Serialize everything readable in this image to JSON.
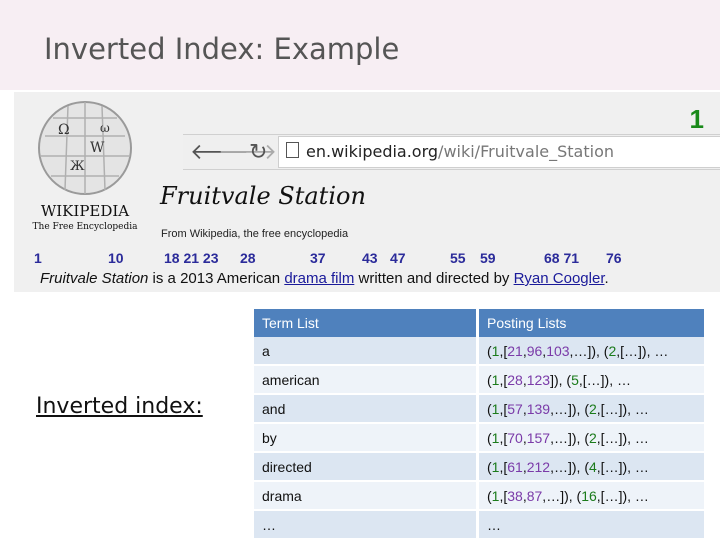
{
  "slide": {
    "title": "Inverted Index: Example",
    "page_number": "1"
  },
  "browser": {
    "url_domain": "en.wikipedia.org",
    "url_path": "/wiki/Fruitvale_Station"
  },
  "wikipedia": {
    "logo_name": "WIKIPEDIA",
    "logo_tagline": "The Free Encyclopedia"
  },
  "article": {
    "title": "Fruitvale Station",
    "subtitle": "From Wikipedia, the free encyclopedia",
    "sentence_italic": "Fruitvale Station",
    "sentence_part1": " is a 2013 American ",
    "link1": "drama film",
    "sentence_part2": " written and directed by ",
    "link2": "Ryan Coogler",
    "sentence_end": "."
  },
  "positions": [
    "1",
    "10",
    "18 21 23",
    "28",
    "37",
    "43",
    "47",
    "55",
    "59",
    "68 71",
    "76"
  ],
  "inverted_index_label": "Inverted index:",
  "table": {
    "headers": [
      "Term List",
      "Posting Lists"
    ],
    "rows": [
      {
        "term": "a",
        "posting": "(1,[21,96,103,…]), (2,[…]), …"
      },
      {
        "term": "american",
        "posting": "(1,[28,123]), (5,[…]), …"
      },
      {
        "term": "and",
        "posting": "(1,[57,139,…]), (2,[…]), …"
      },
      {
        "term": "by",
        "posting": "(1,[70,157,…]), (2,[…]), …"
      },
      {
        "term": "directed",
        "posting": "(1,[61,212,…]), (4,[…]), …"
      },
      {
        "term": "drama",
        "posting": "(1,[38,87,…]), (16,[…]), …"
      },
      {
        "term": "…",
        "posting": "…"
      }
    ]
  }
}
